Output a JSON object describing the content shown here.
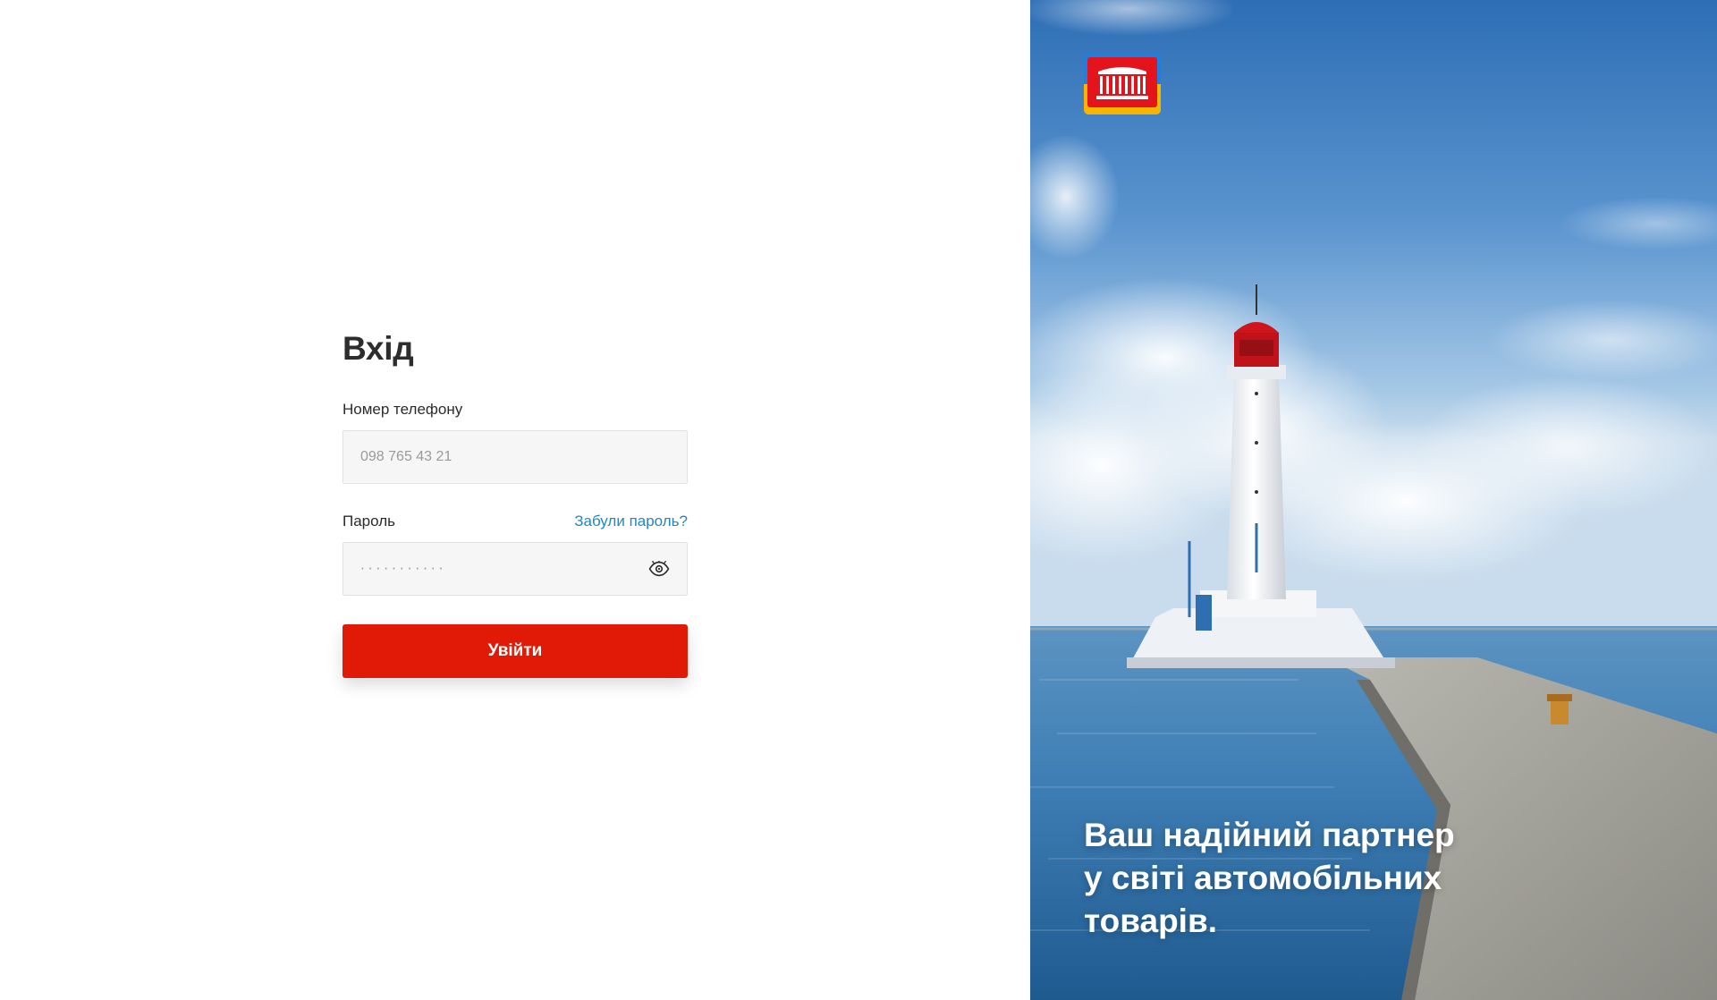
{
  "login": {
    "title": "Вхід",
    "phone": {
      "label": "Номер телефону",
      "placeholder": "098 765 43 21",
      "value": ""
    },
    "password": {
      "label": "Пароль",
      "masked_value": "···········",
      "forgot_link": "Забули пароль?",
      "toggle_icon": "eye-icon"
    },
    "submit_label": "Увійти"
  },
  "hero": {
    "logo_icon": "building-columns-logo",
    "tagline": "Ваш надійний партнер\nу світі автомобільних\nтоварів.",
    "image": "lighthouse-sea-pier-photo"
  },
  "colors": {
    "accent": "#e01a06",
    "link": "#1f86c6",
    "input_bg": "#f6f6f6",
    "logo_red": "#e3141b",
    "logo_blue": "#1f7fe0",
    "logo_yellow": "#f7b500"
  }
}
